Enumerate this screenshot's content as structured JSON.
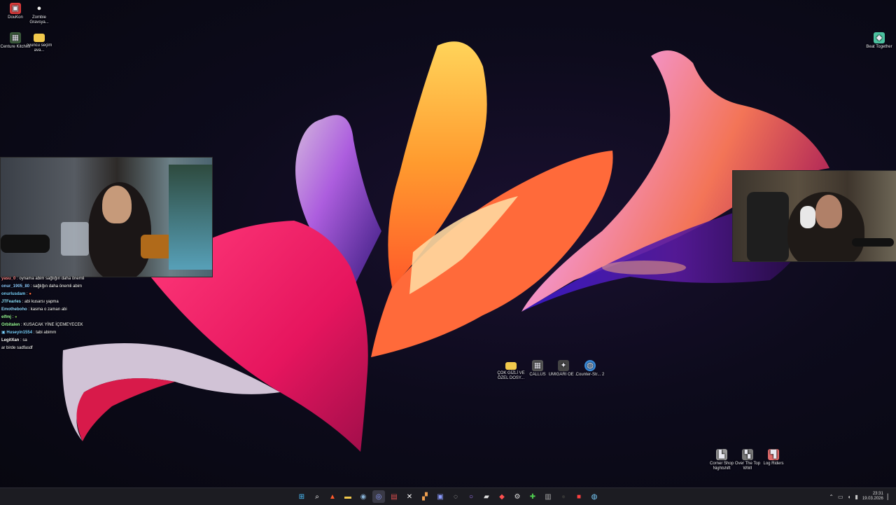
{
  "desktop": {
    "icons_top_left": [
      {
        "label": "DouKon",
        "icon": "app-icon",
        "color": "#d83b3b"
      },
      {
        "label": "Zombie Gravsya...",
        "icon": "app-icon",
        "color": "#e0e0e0"
      },
      {
        "label": "Centure Kitchen",
        "icon": "app-icon",
        "color": "#3b7a3b"
      },
      {
        "label": "oyuncu seçim ava...",
        "icon": "folder-icon",
        "color": "#f2c94c"
      }
    ],
    "icon_top_right": {
      "label": "Beat Together",
      "icon": "app-icon",
      "color": "#4cc2a0"
    },
    "icons_center": [
      {
        "label": "ÇOK GİZLİ VE ÖZEL DOSY...",
        "icon": "folder-icon",
        "color": "#f2c94c"
      },
      {
        "label": "CALLUS",
        "icon": "app-icon",
        "color": "#555"
      },
      {
        "label": "UMIGARI OE ...",
        "icon": "app-icon",
        "color": "#444"
      },
      {
        "label": "Counter-Str... 2",
        "icon": "app-icon",
        "color": "#3a8ad8"
      }
    ],
    "icons_bottom": [
      {
        "label": "Corner Shop Nightshift",
        "icon": "app-icon",
        "color": "#999"
      },
      {
        "label": "Over The Top WWI",
        "icon": "app-icon",
        "color": "#777"
      },
      {
        "label": "Log Riders",
        "icon": "app-icon",
        "color": "#e06b6b"
      }
    ]
  },
  "chat": {
    "messages": [
      {
        "user": "yasu_0",
        "text": "oynama abim sağlığın daha önemli",
        "color": "#ff8c8c"
      },
      {
        "user": "onur_1905_80",
        "text": "sağlığın daha önemli abim",
        "color": "#8cc8ff"
      },
      {
        "user": "onurlusdam",
        "text": "",
        "color": "#7ad0ff"
      },
      {
        "user": "JTFearles",
        "text": "abi kusarsı yapma",
        "color": "#8ce0ff"
      },
      {
        "user": "Emotheboho",
        "text": "kasma o zaman abi",
        "color": "#8fd6ff"
      },
      {
        "user": "elfmj",
        "text": "",
        "color": "#9cff9c"
      },
      {
        "user": "Orbitalen",
        "text": "KUSACAK YİNE İÇEMEYECEK",
        "color": "#9cff9c"
      },
      {
        "user": "Huseyin1554",
        "text": "tabi abimm",
        "color": "#7ad0ff"
      },
      {
        "user": "LegitXan",
        "text": "sa",
        "color": "#ffffff"
      },
      {
        "user": "",
        "text": "ar birde sadfasdf",
        "color": "#ffffff"
      }
    ]
  },
  "taskbar": {
    "apps": [
      {
        "name": "start-icon",
        "glyph": "⊞",
        "color": "#4cc2ff"
      },
      {
        "name": "search-icon",
        "glyph": "⌕",
        "color": "#ffffff"
      },
      {
        "name": "brave-icon",
        "glyph": "▲",
        "color": "#ff5a2b"
      },
      {
        "name": "file-explorer-icon",
        "glyph": "▬",
        "color": "#f2c94c"
      },
      {
        "name": "steam-icon",
        "glyph": "◉",
        "color": "#8ab4d8"
      },
      {
        "name": "discord-icon",
        "glyph": "◎",
        "color": "#8c9cff",
        "active": true
      },
      {
        "name": "app-icon",
        "glyph": "▤",
        "color": "#e05050"
      },
      {
        "name": "app-icon",
        "glyph": "✕",
        "color": "#ffffff"
      },
      {
        "name": "app-icon",
        "glyph": "▞",
        "color": "#f0a050"
      },
      {
        "name": "app-icon",
        "glyph": "▣",
        "color": "#8c9cff"
      },
      {
        "name": "app-icon",
        "glyph": "◌",
        "color": "#cccccc"
      },
      {
        "name": "app-icon",
        "glyph": "○",
        "color": "#a77cff"
      },
      {
        "name": "app-icon",
        "glyph": "▰",
        "color": "#e0e0e0"
      },
      {
        "name": "app-icon",
        "glyph": "◆",
        "color": "#ff5050"
      },
      {
        "name": "gear-icon",
        "glyph": "⚙",
        "color": "#dddddd"
      },
      {
        "name": "xbox-icon",
        "glyph": "✚",
        "color": "#50d050"
      },
      {
        "name": "app-icon",
        "glyph": "▥",
        "color": "#aaaaaa"
      },
      {
        "name": "app-icon",
        "glyph": "●",
        "color": "#333333"
      },
      {
        "name": "app-icon",
        "glyph": "■",
        "color": "#ff4040"
      },
      {
        "name": "app-icon",
        "glyph": "◍",
        "color": "#7ad0ff"
      }
    ],
    "tray_icons": [
      "chevron-up-icon",
      "network-icon",
      "volume-icon",
      "battery-icon"
    ],
    "clock": {
      "time": "23:31",
      "date": "19.03.2026"
    }
  }
}
